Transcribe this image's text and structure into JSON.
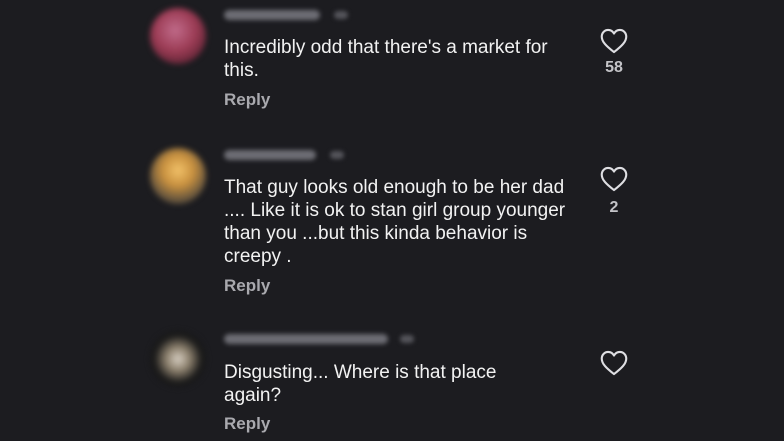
{
  "comments": [
    {
      "text": "Incredibly odd that there's a market for this.",
      "reply_label": "Reply",
      "like_count": "58",
      "like_icon": "heart-outline-icon"
    },
    {
      "text": "That guy looks old enough to be her dad .... Like it is ok  to stan girl group younger than you ...but this kinda behavior is creepy .",
      "reply_label": "Reply",
      "like_count": "2",
      "like_icon": "heart-outline-icon"
    },
    {
      "text": "Disgusting... Where is that place again?",
      "reply_label": "Reply",
      "like_count": "",
      "like_icon": "heart-outline-icon"
    }
  ],
  "colors": {
    "background": "#1c1c20",
    "text": "#f2f2f2",
    "secondary_text": "#a9a9ae"
  }
}
